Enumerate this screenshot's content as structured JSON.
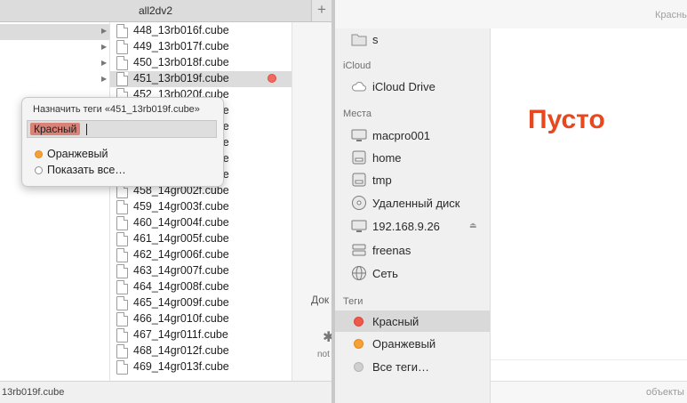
{
  "left_window": {
    "tab_title": "all2dv2",
    "tab_add": "+",
    "files": [
      {
        "name": "448_13rb016f.cube"
      },
      {
        "name": "449_13rb017f.cube"
      },
      {
        "name": "450_13rb018f.cube"
      },
      {
        "name": "451_13rb019f.cube",
        "selected": true,
        "tag": "red"
      },
      {
        "name": "452_13rb020f.cube"
      },
      {
        "name": "453_13rb021f.cube"
      },
      {
        "name": "454_13rb022f.cube"
      },
      {
        "name": "455_13rb023f.cube"
      },
      {
        "name": "456_13rb024f.cube"
      },
      {
        "name": "457_14gr001f.cube"
      },
      {
        "name": "458_14gr002f.cube"
      },
      {
        "name": "459_14gr003f.cube"
      },
      {
        "name": "460_14gr004f.cube"
      },
      {
        "name": "461_14gr005f.cube"
      },
      {
        "name": "462_14gr006f.cube"
      },
      {
        "name": "463_14gr007f.cube"
      },
      {
        "name": "464_14gr008f.cube"
      },
      {
        "name": "465_14gr009f.cube"
      },
      {
        "name": "466_14gr010f.cube"
      },
      {
        "name": "467_14gr011f.cube"
      },
      {
        "name": "468_14gr012f.cube"
      },
      {
        "name": "469_14gr013f.cube"
      }
    ],
    "preview_column": {
      "label": "Док",
      "note": "not"
    },
    "pathbar": "13rb019f.cube"
  },
  "tag_popover": {
    "title": "Назначить теги «451_13rb019f.cube»",
    "token": "Красный",
    "suggestions": [
      {
        "label": "Оранжевый",
        "color": "orange"
      },
      {
        "label": "Показать все…",
        "color": "empty"
      }
    ]
  },
  "right_window": {
    "title": "Красны",
    "sidebar": {
      "top_item": "s",
      "icloud_heading": "iCloud",
      "icloud_items": [
        "iCloud Drive"
      ],
      "places_heading": "Места",
      "places_items": [
        "macpro001",
        "home",
        "tmp",
        "Удаленный диск",
        "192.168.9.26",
        "freenas",
        "Сеть"
      ],
      "tags_heading": "Теги",
      "tags_items": [
        {
          "label": "Красный",
          "color": "#f0594a",
          "selected": true
        },
        {
          "label": "Оранжевый",
          "color": "#f6a133"
        },
        {
          "label": "Все теги…",
          "color": "#cfcfcf"
        }
      ]
    },
    "empty_text": "Пусто",
    "status_text": "объекты"
  },
  "colors": {
    "accent_empty": "#e8481f",
    "tag_red": "#f0594a",
    "tag_orange": "#f6a133"
  }
}
